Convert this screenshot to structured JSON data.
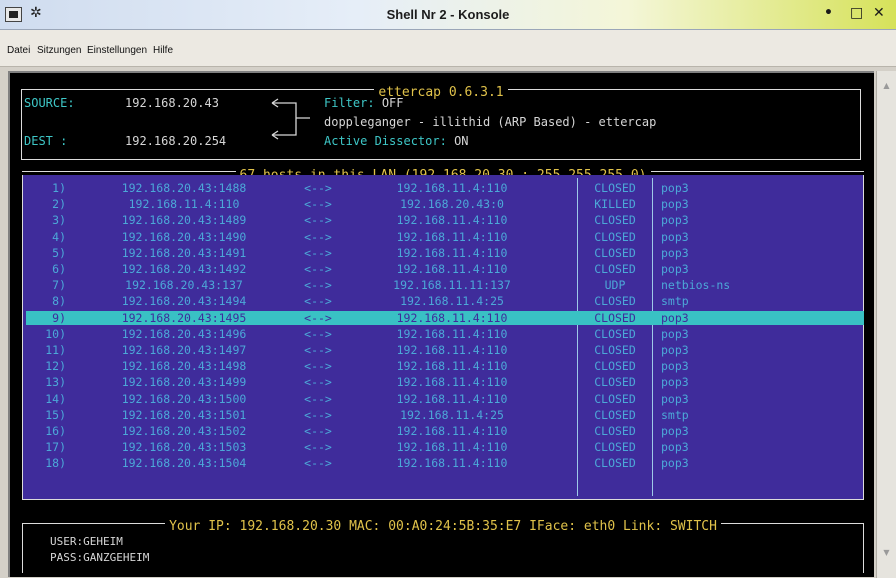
{
  "window": {
    "title": "Shell Nr 2 - Konsole",
    "pin_glyph": "✲",
    "min_glyph": "•",
    "max_glyph": "□",
    "close_glyph": "✕"
  },
  "menu": [
    "Datei",
    "Sitzungen",
    "Einstellungen",
    "Hilfe"
  ],
  "header": {
    "title": "ettercap 0.6.3.1",
    "source_label": "SOURCE:",
    "source_value": "192.168.20.43",
    "dest_label": "DEST  :",
    "dest_value": "192.168.20.254",
    "filter_key": "Filter:",
    "filter_value": "OFF",
    "plugin_line": "doppleganger - illithid (ARP Based) - ettercap",
    "dissector_key": "Active Dissector:",
    "dissector_value": "ON"
  },
  "connections": {
    "title": "67 hosts in this LAN (192.168.20.30 : 255.255.255.0)",
    "selected_index": 8,
    "rows": [
      [
        "1)",
        "192.168.20.43:1488",
        "<-->",
        "192.168.11.4:110",
        "CLOSED",
        "pop3"
      ],
      [
        "2)",
        "192.168.11.4:110",
        "<-->",
        "192.168.20.43:0",
        "KILLED",
        "pop3"
      ],
      [
        "3)",
        "192.168.20.43:1489",
        "<-->",
        "192.168.11.4:110",
        "CLOSED",
        "pop3"
      ],
      [
        "4)",
        "192.168.20.43:1490",
        "<-->",
        "192.168.11.4:110",
        "CLOSED",
        "pop3"
      ],
      [
        "5)",
        "192.168.20.43:1491",
        "<-->",
        "192.168.11.4:110",
        "CLOSED",
        "pop3"
      ],
      [
        "6)",
        "192.168.20.43:1492",
        "<-->",
        "192.168.11.4:110",
        "CLOSED",
        "pop3"
      ],
      [
        "7)",
        "192.168.20.43:137",
        "<-->",
        "192.168.11.11:137",
        "UDP",
        "netbios-ns"
      ],
      [
        "8)",
        "192.168.20.43:1494",
        "<-->",
        "192.168.11.4:25",
        "CLOSED",
        "smtp"
      ],
      [
        "9)",
        "192.168.20.43:1495",
        "<-->",
        "192.168.11.4:110",
        "CLOSED",
        "pop3"
      ],
      [
        "10)",
        "192.168.20.43:1496",
        "<-->",
        "192.168.11.4:110",
        "CLOSED",
        "pop3"
      ],
      [
        "11)",
        "192.168.20.43:1497",
        "<-->",
        "192.168.11.4:110",
        "CLOSED",
        "pop3"
      ],
      [
        "12)",
        "192.168.20.43:1498",
        "<-->",
        "192.168.11.4:110",
        "CLOSED",
        "pop3"
      ],
      [
        "13)",
        "192.168.20.43:1499",
        "<-->",
        "192.168.11.4:110",
        "CLOSED",
        "pop3"
      ],
      [
        "14)",
        "192.168.20.43:1500",
        "<-->",
        "192.168.11.4:110",
        "CLOSED",
        "pop3"
      ],
      [
        "15)",
        "192.168.20.43:1501",
        "<-->",
        "192.168.11.4:25",
        "CLOSED",
        "smtp"
      ],
      [
        "16)",
        "192.168.20.43:1502",
        "<-->",
        "192.168.11.4:110",
        "CLOSED",
        "pop3"
      ],
      [
        "17)",
        "192.168.20.43:1503",
        "<-->",
        "192.168.11.4:110",
        "CLOSED",
        "pop3"
      ],
      [
        "18)",
        "192.168.20.43:1504",
        "<-->",
        "192.168.11.4:110",
        "CLOSED",
        "pop3"
      ]
    ]
  },
  "footer": {
    "title": "Your IP: 192.168.20.30 MAC: 00:A0:24:5B:35:E7 IFace: eth0 Link: SWITCH",
    "user_label": "USER:",
    "user_value": "GEHEIM",
    "pass_label": "PASS:",
    "pass_value": "GANZGEHEIM"
  },
  "colors": {
    "panel_bg": "#3f2c9b",
    "row_text": "#4ca8d8",
    "selection": "#39c1c4",
    "title_text": "#e0c24a",
    "label_cyan": "#3ec7c7"
  }
}
